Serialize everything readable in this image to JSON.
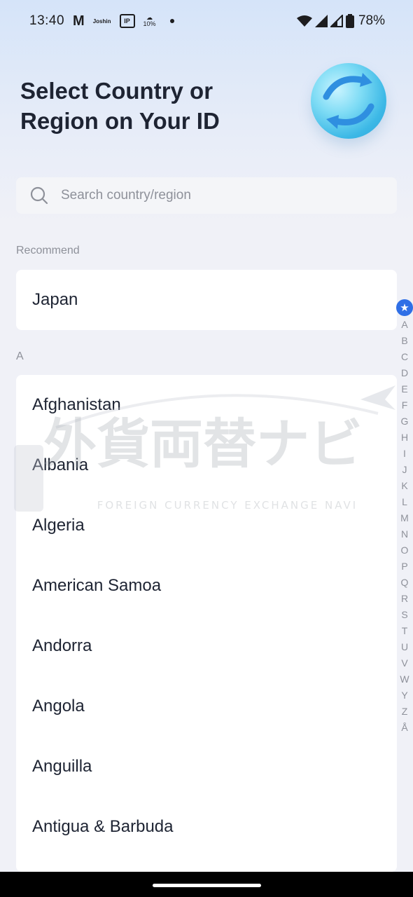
{
  "status_bar": {
    "time": "13:40",
    "notif_gmail": "M",
    "notif_joshin": "Joshin",
    "notif_ip": "IP",
    "notif_weather_pct": "10%",
    "battery_pct": "78%"
  },
  "header": {
    "title": "Select Country or Region on Your ID"
  },
  "search": {
    "placeholder": "Search country/region",
    "value": ""
  },
  "recommend": {
    "label": "Recommend",
    "items": [
      {
        "label": "Japan"
      }
    ]
  },
  "section_a": {
    "label": "A",
    "items": [
      {
        "label": "Afghanistan"
      },
      {
        "label": "Albania"
      },
      {
        "label": "Algeria"
      },
      {
        "label": "American Samoa"
      },
      {
        "label": "Andorra"
      },
      {
        "label": "Angola"
      },
      {
        "label": "Anguilla"
      },
      {
        "label": "Antigua & Barbuda"
      }
    ]
  },
  "index_bar": {
    "star": "★",
    "letters": [
      "A",
      "B",
      "C",
      "D",
      "E",
      "F",
      "G",
      "H",
      "I",
      "J",
      "K",
      "L",
      "M",
      "N",
      "O",
      "P",
      "Q",
      "R",
      "S",
      "T",
      "U",
      "V",
      "W",
      "Y",
      "Z",
      "Å"
    ]
  },
  "watermark": {
    "text": "外貨両替ナビ",
    "subtext": "FOREIGN CURRENCY EXCHANGE NAVI"
  },
  "colors": {
    "accent": "#2f6fe6",
    "text_primary": "#1e2433",
    "text_secondary": "#8e919a",
    "background": "#f0f1f7"
  }
}
